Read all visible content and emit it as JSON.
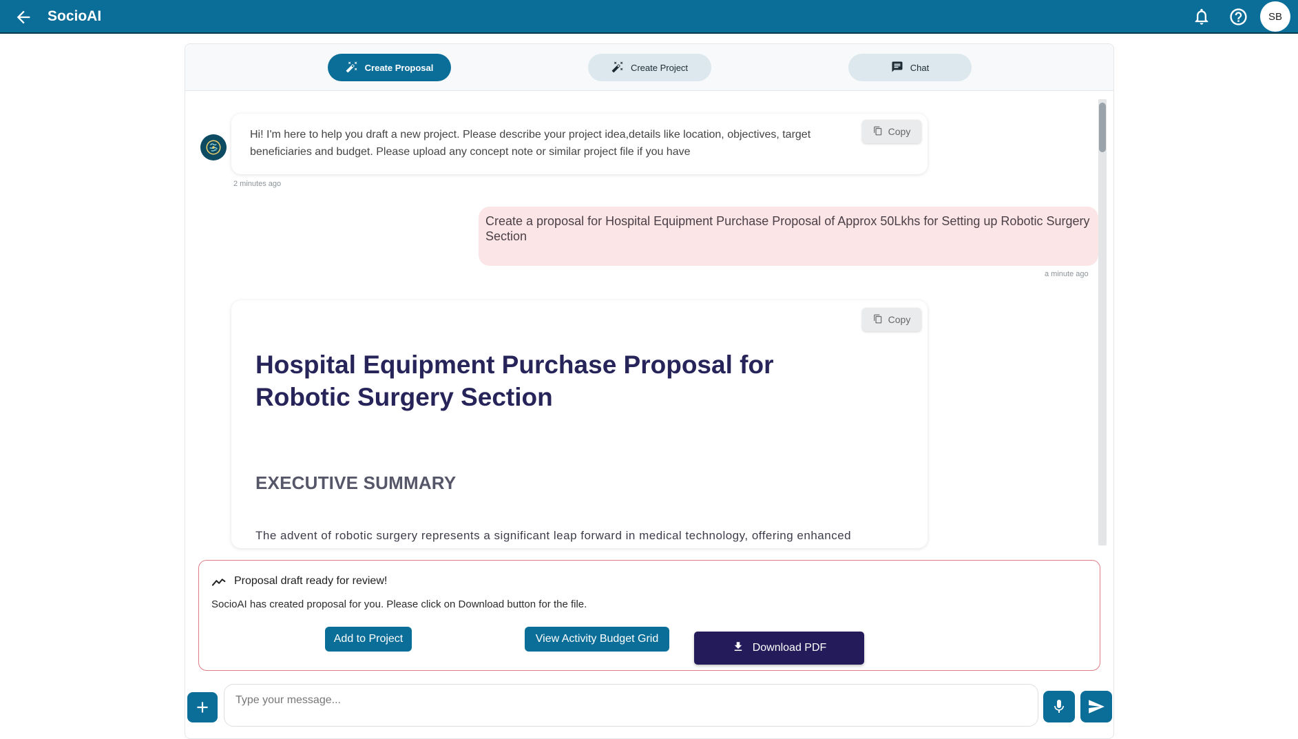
{
  "app": {
    "title": "SocioAI",
    "user_initials": "SB"
  },
  "tabs": [
    {
      "label": "Create Proposal",
      "icon": "magic-wand-icon",
      "active": true
    },
    {
      "label": "Create Project",
      "icon": "magic-wand-icon",
      "active": false
    },
    {
      "label": "Chat",
      "icon": "chat-icon",
      "active": false
    }
  ],
  "messages": {
    "bot_intro": {
      "text": "Hi! I'm here to help you draft a new project. Please describe your project idea,details like location, objectives, target beneficiaries and budget. Please upload any concept note or similar project file if you have",
      "time": "2 minutes ago",
      "copy_label": "Copy"
    },
    "user_request": {
      "text": "Create a proposal for Hospital Equipment Purchase Proposal of Approx 50Lkhs for Setting up Robotic Surgery Section",
      "time": "a minute ago"
    },
    "proposal_doc": {
      "copy_label": "Copy",
      "title": "Hospital Equipment Purchase Proposal for Robotic Surgery Section",
      "section_heading": "EXECUTIVE SUMMARY",
      "paragraph": "The advent of robotic surgery represents a significant leap forward in medical technology, offering enhanced"
    }
  },
  "notice": {
    "title": "Proposal draft ready for review!",
    "description": "SocioAI has created proposal for you. Please click on Download button for the file.",
    "add_to_project_label": "Add to Project",
    "view_budget_label": "View Activity Budget Grid",
    "download_label": "Download PDF"
  },
  "composer": {
    "placeholder": "Type your message..."
  },
  "colors": {
    "primary": "#0b6e99",
    "download_button": "#241b5a",
    "user_bubble": "#fbe5e6",
    "notice_border": "#e07c88",
    "doc_title": "#27245a"
  }
}
